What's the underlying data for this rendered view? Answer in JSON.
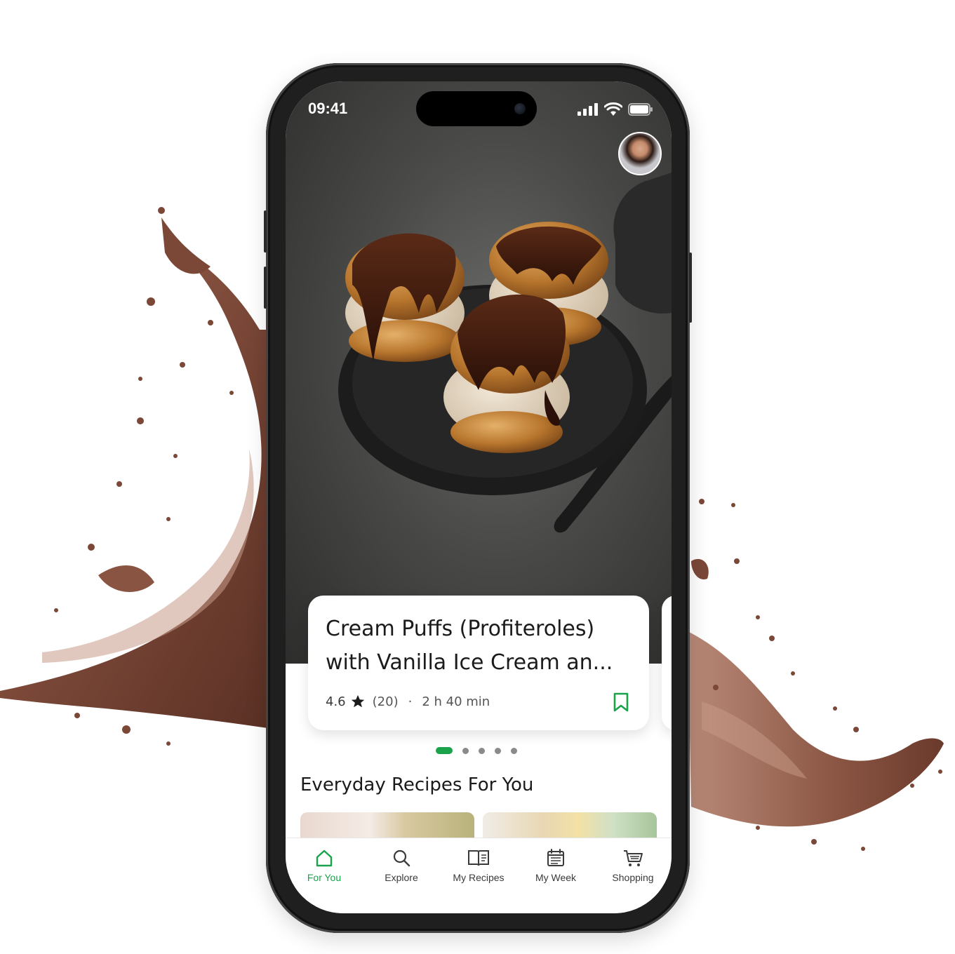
{
  "status_bar": {
    "time": "09:41"
  },
  "recipe_card": {
    "title": "Cream Puffs (Profiteroles) with Vanilla Ice Cream an...",
    "rating": "4.6",
    "reviews": "(20)",
    "separator": "·",
    "duration": "2 h 40 min"
  },
  "carousel": {
    "page_count": 5,
    "active_index": 0
  },
  "section": {
    "title": "Everyday Recipes For You"
  },
  "tabbar": {
    "items": [
      {
        "label": "For You",
        "icon": "home-icon",
        "active": true
      },
      {
        "label": "Explore",
        "icon": "search-icon",
        "active": false
      },
      {
        "label": "My Recipes",
        "icon": "book-icon",
        "active": false
      },
      {
        "label": "My Week",
        "icon": "calendar-icon",
        "active": false
      },
      {
        "label": "Shopping",
        "icon": "cart-icon",
        "active": false
      }
    ]
  },
  "colors": {
    "accent": "#1aa34a",
    "chocolate": "#7a4535"
  }
}
